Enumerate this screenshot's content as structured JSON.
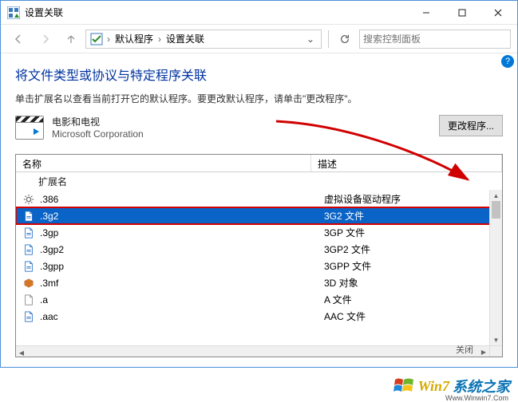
{
  "titlebar": {
    "title": "设置关联"
  },
  "nav": {
    "breadcrumb": [
      "默认程序",
      "设置关联"
    ],
    "search_placeholder": "搜索控制面板"
  },
  "page": {
    "heading": "将文件类型或协议与特定程序关联",
    "subtext": "单击扩展名以查看当前打开它的默认程序。要更改默认程序，请单击\"更改程序\"。",
    "help": "?",
    "program": {
      "name": "电影和电视",
      "corp": "Microsoft Corporation"
    },
    "change_btn": "更改程序..."
  },
  "list": {
    "col_name": "名称",
    "col_desc": "描述",
    "group": "扩展名",
    "rows": [
      {
        "ext": ".386",
        "desc": "虚拟设备驱动程序",
        "icon": "gear"
      },
      {
        "ext": ".3g2",
        "desc": "3G2 文件",
        "icon": "file",
        "selected": true
      },
      {
        "ext": ".3gp",
        "desc": "3GP 文件",
        "icon": "file"
      },
      {
        "ext": ".3gp2",
        "desc": "3GP2 文件",
        "icon": "file"
      },
      {
        "ext": ".3gpp",
        "desc": "3GPP 文件",
        "icon": "file"
      },
      {
        "ext": ".3mf",
        "desc": "3D 对象",
        "icon": "cube"
      },
      {
        "ext": ".a",
        "desc": "A 文件",
        "icon": "blank"
      },
      {
        "ext": ".aac",
        "desc": "AAC 文件",
        "icon": "file"
      }
    ],
    "close": "关闭"
  },
  "watermark": {
    "t1": "Win7",
    "t2": "系统之家",
    "url": "Www.Winwin7.Com"
  }
}
